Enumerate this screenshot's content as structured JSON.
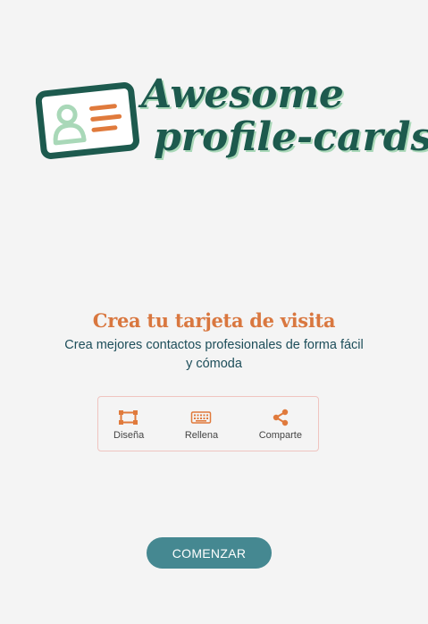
{
  "logo": {
    "line1": "Awesome",
    "line2": "profile-cards",
    "icon": "id-card-icon"
  },
  "hero": {
    "title": "Crea tu tarjeta de visita",
    "subtitle": "Crea mejores contactos profesionales de forma fácil y cómoda"
  },
  "features": [
    {
      "label": "Diseña",
      "icon": "design-icon"
    },
    {
      "label": "Rellena",
      "icon": "keyboard-icon"
    },
    {
      "label": "Comparte",
      "icon": "share-icon"
    }
  ],
  "actions": {
    "start_label": "COMENZAR"
  },
  "colors": {
    "background": "#f4f4f4",
    "primary_dark": "#1d5a4e",
    "accent_orange": "#d9773f",
    "button": "#458891",
    "logo_green_light": "#a9d8b8",
    "feature_border": "#efc4c0"
  }
}
